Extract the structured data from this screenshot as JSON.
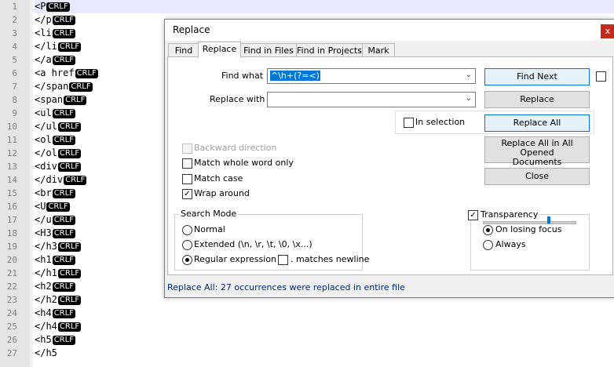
{
  "editor": {
    "line_numbers": [
      "1",
      "2",
      "3",
      "4",
      "5",
      "6",
      "7",
      "8",
      "9",
      "10",
      "11",
      "12",
      "13",
      "14",
      "15",
      "16",
      "17",
      "18",
      "19",
      "20",
      "21",
      "22",
      "23",
      "24",
      "25",
      "26",
      "27"
    ],
    "lines": [
      {
        "text": "<P",
        "eol": true
      },
      {
        "text": "</p",
        "eol": true
      },
      {
        "text": "<li",
        "eol": true
      },
      {
        "text": "</li",
        "eol": true
      },
      {
        "text": "</a",
        "eol": true
      },
      {
        "text": "<a href",
        "eol": true
      },
      {
        "text": "</span",
        "eol": true
      },
      {
        "text": "<span",
        "eol": true
      },
      {
        "text": "<ul",
        "eol": true
      },
      {
        "text": "</ul",
        "eol": true
      },
      {
        "text": "<ol",
        "eol": true
      },
      {
        "text": "</ol",
        "eol": true
      },
      {
        "text": "<div",
        "eol": true
      },
      {
        "text": "</div",
        "eol": true
      },
      {
        "text": "<br",
        "eol": true
      },
      {
        "text": "<U",
        "eol": true
      },
      {
        "text": "</u",
        "eol": true
      },
      {
        "text": "<H3",
        "eol": true
      },
      {
        "text": "</h3",
        "eol": true
      },
      {
        "text": "<h1",
        "eol": true
      },
      {
        "text": "</h1",
        "eol": true
      },
      {
        "text": "<h2",
        "eol": true
      },
      {
        "text": "</h2",
        "eol": true
      },
      {
        "text": "<h4",
        "eol": true
      },
      {
        "text": "</h4",
        "eol": true
      },
      {
        "text": "<h5",
        "eol": true
      },
      {
        "text": "</h5",
        "eol": false
      }
    ],
    "eol_marker": "CRLF"
  },
  "dialog": {
    "title": "Replace",
    "close_glyph": "x",
    "tabs": [
      "Find",
      "Replace",
      "Find in Files",
      "Find in Projects",
      "Mark"
    ],
    "selected_tab": "Replace",
    "find_label": "Find what :",
    "find_value": "^\\h+(?=<)",
    "replace_label": "Replace with :",
    "replace_value": "",
    "in_selection": "In selection",
    "buttons": {
      "find_next": "Find Next",
      "replace": "Replace",
      "replace_all": "Replace All",
      "replace_all_open_1": "Replace All in All Opened",
      "replace_all_open_2": "Documents",
      "close": "Close"
    },
    "options": {
      "backward": "Backward direction",
      "whole_word": "Match whole word only",
      "match_case": "Match case",
      "wrap_around": "Wrap around"
    },
    "search_mode": {
      "title": "Search Mode",
      "normal": "Normal",
      "extended": "Extended (\\n, \\r, \\t, \\0, \\x...)",
      "regex": "Regular expression",
      "matches_newline": ". matches newline",
      "selected": "regex"
    },
    "transparency": {
      "title": "Transparency",
      "on_losing_focus": "On losing focus",
      "always": "Always",
      "level": 0.72
    },
    "status": "Replace All: 27 occurrences were replaced in entire file",
    "colors": {
      "accent": "#0078d7",
      "close": "#c42b1c",
      "status": "#00287a"
    }
  }
}
